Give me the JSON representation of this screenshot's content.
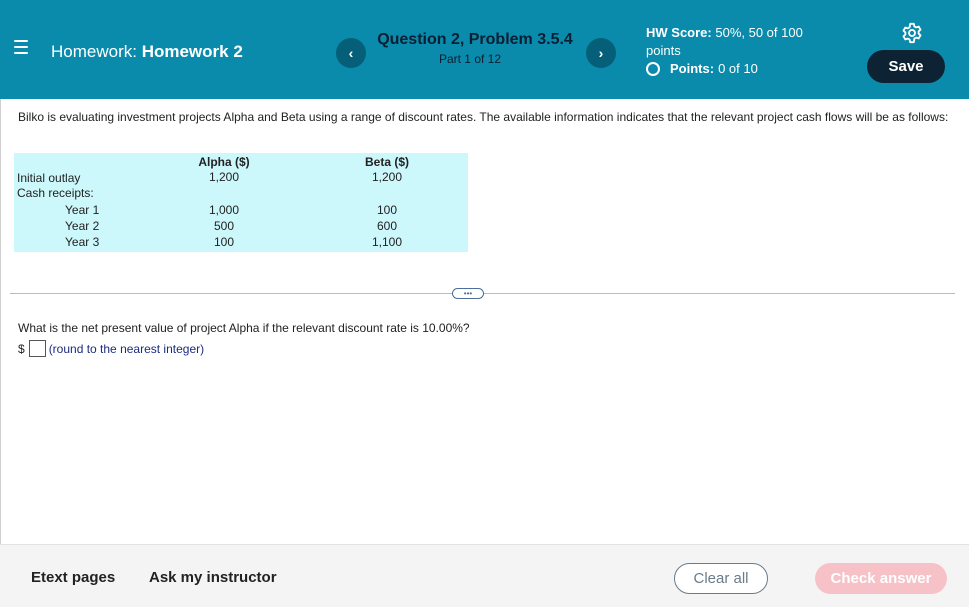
{
  "header": {
    "title_prefix": "Homework:",
    "title_name": "Homework 2",
    "question_title": "Question 2, Problem 3.5.4",
    "question_part": "Part 1 of 12",
    "prev_label": "‹",
    "next_label": "›",
    "score_label": "HW Score:",
    "score_value": "50%, 50 of 100",
    "score_unit": "points",
    "points_label": "Points:",
    "points_value": "0 of 10",
    "save_label": "Save",
    "icons": {
      "menu": "hamburger-menu-icon",
      "settings": "gear-icon",
      "points": "circle-icon"
    }
  },
  "problem": {
    "intro": "Bilko is evaluating investment projects Alpha and Beta using a range of discount rates.  The available information indicates that the relevant project cash flows will be as follows:",
    "table": {
      "col_alpha": "Alpha ($)",
      "col_beta": "Beta ($)",
      "rows": [
        {
          "label": "Initial outlay",
          "alpha": "1,200",
          "beta": "1,200"
        },
        {
          "label": "Cash receipts:",
          "alpha": "",
          "beta": ""
        },
        {
          "label": "Year 1",
          "alpha": "1,000",
          "beta": "100"
        },
        {
          "label": "Year 2",
          "alpha": "500",
          "beta": "600"
        },
        {
          "label": "Year 3",
          "alpha": "100",
          "beta": "1,100"
        }
      ]
    },
    "expand_label": "•••",
    "question": "What is the net present value of project Alpha if the relevant discount rate is 10.00%?",
    "currency": "$",
    "answer_value": "",
    "answer_hint": "(round to the nearest integer)"
  },
  "footer": {
    "etext_label": "Etext pages",
    "ask_label": "Ask my instructor",
    "clear_label": "Clear all",
    "check_label": "Check answer"
  },
  "colors": {
    "header_bg": "#0a8bab",
    "nav_btn": "#055f78",
    "save_btn": "#0d2334",
    "table_bg": "#ccf7fb",
    "check_btn_disabled": "#f7c1c8"
  }
}
